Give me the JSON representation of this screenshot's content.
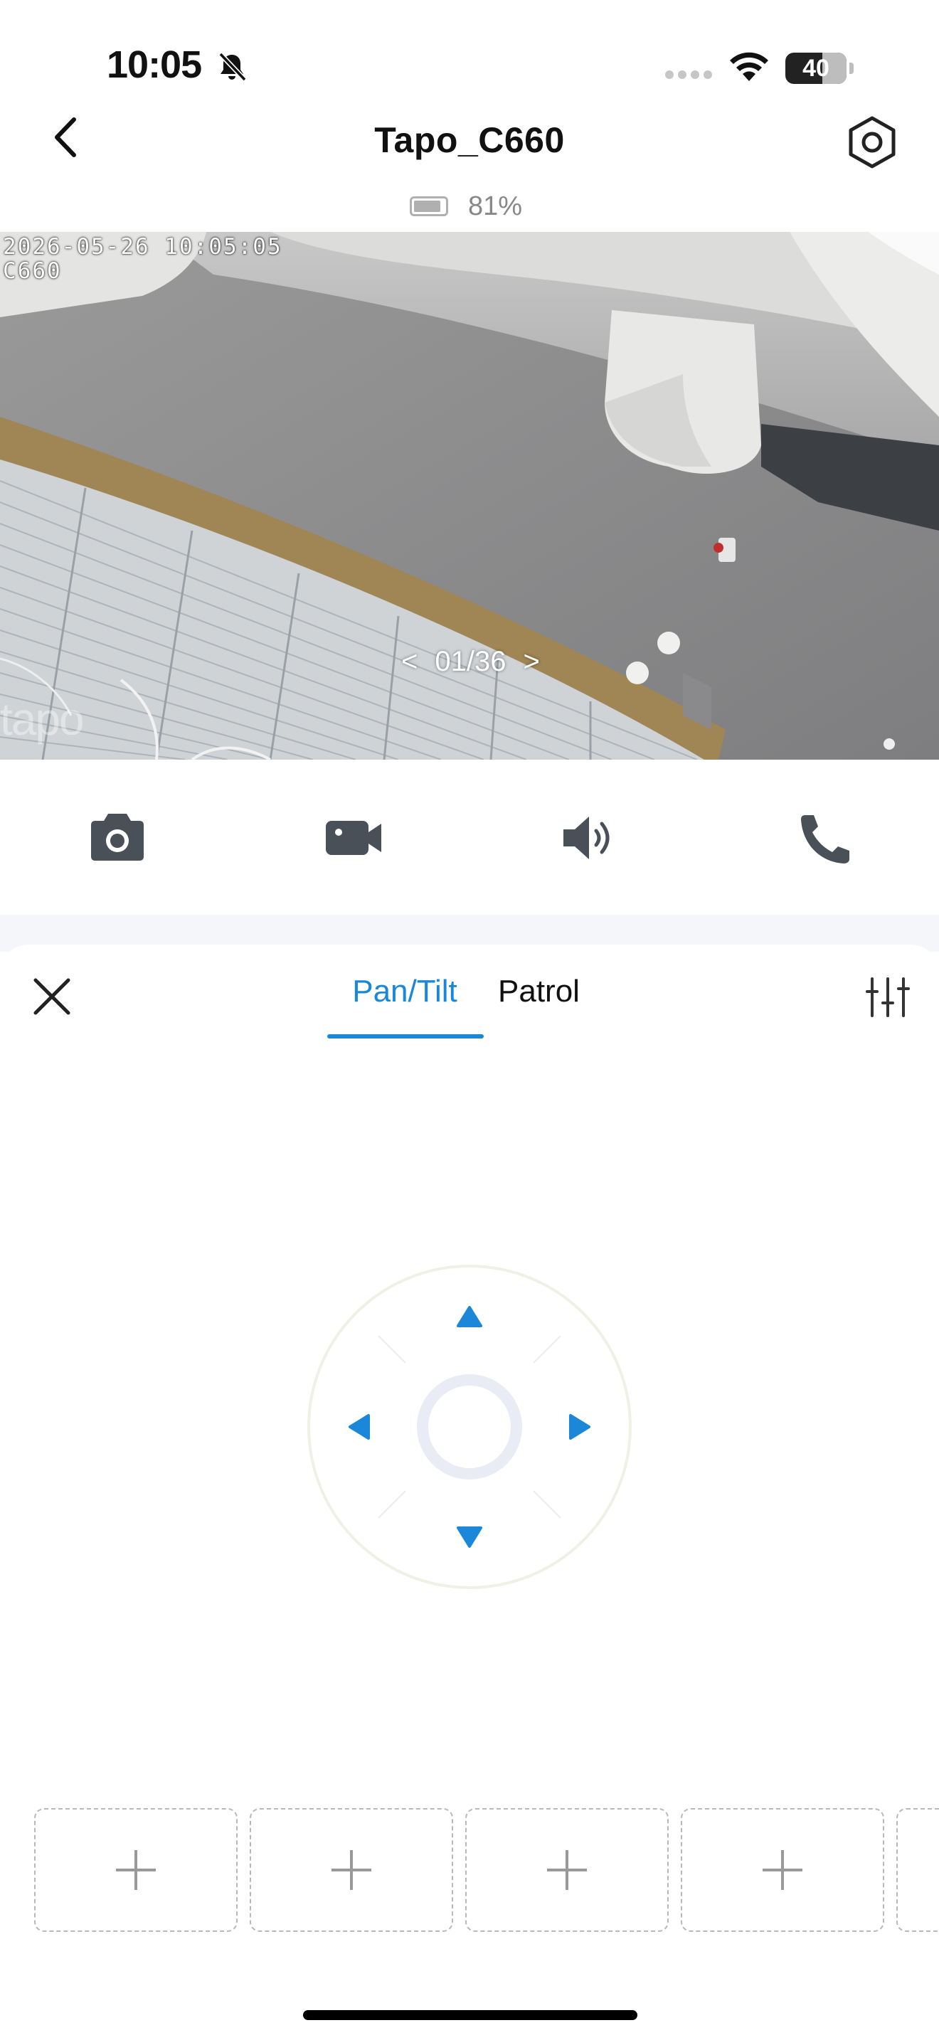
{
  "status_bar": {
    "time": "10:05",
    "battery_level": "40"
  },
  "header": {
    "title": "Tapo_C660"
  },
  "device": {
    "battery_percent": "81%"
  },
  "camera": {
    "timestamp": "2026-05-26 10:05:05",
    "camera_name": "C660",
    "watermark": "tapo",
    "pager": {
      "prev": "<",
      "position": "01/36",
      "next": ">"
    }
  },
  "controls": [
    {
      "name": "snapshot",
      "icon": "camera-icon"
    },
    {
      "name": "record",
      "icon": "video-camera-icon"
    },
    {
      "name": "speaker",
      "icon": "speaker-icon"
    },
    {
      "name": "call",
      "icon": "phone-icon"
    }
  ],
  "ptz_panel": {
    "tabs": [
      {
        "label": "Pan/Tilt",
        "active": true
      },
      {
        "label": "Patrol",
        "active": false
      }
    ],
    "presets": [
      {
        "icon": "plus-icon"
      },
      {
        "icon": "plus-icon"
      },
      {
        "icon": "plus-icon"
      },
      {
        "icon": "plus-icon"
      },
      {
        "icon": "plus-icon"
      }
    ]
  },
  "colors": {
    "accent": "#1a87d8",
    "icon_gray": "#4a5058",
    "panel_bg": "#f4f6fa"
  }
}
